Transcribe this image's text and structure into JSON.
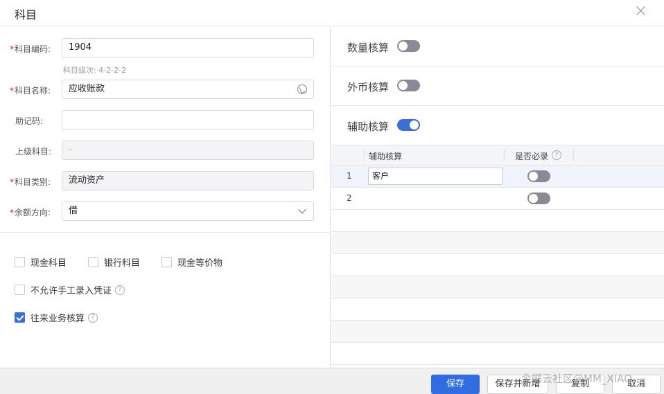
{
  "dialog": {
    "title": "科目"
  },
  "form": {
    "code": {
      "label": "科目编码:",
      "value": "1904",
      "required": true,
      "hint": "科目级次: 4-2-2-2"
    },
    "name": {
      "label": "科目名称:",
      "value": "应收账款",
      "required": true
    },
    "mnemonic": {
      "label": "助记码:",
      "value": ""
    },
    "parent": {
      "label": "上级科目:",
      "value": "-"
    },
    "category": {
      "label": "科目类别:",
      "value": "流动资产",
      "required": true
    },
    "balance_direction": {
      "label": "余额方向:",
      "value": "借",
      "required": true
    }
  },
  "options": {
    "cash": {
      "label": "现金科目",
      "checked": false
    },
    "bank": {
      "label": "银行科目",
      "checked": false
    },
    "cash_equivalent": {
      "label": "现金等价物",
      "checked": false
    },
    "no_manual_entry": {
      "label": "不允许手工录入凭证",
      "checked": false
    },
    "ar_ap": {
      "label": "往来业务核算",
      "checked": true
    },
    "help_glyph": "?"
  },
  "accounting": {
    "quantity": {
      "label": "数量核算",
      "on": false
    },
    "foreign_currency": {
      "label": "外币核算",
      "on": false
    },
    "auxiliary": {
      "label": "辅助核算",
      "on": true
    }
  },
  "aux_table": {
    "columns": {
      "aux": "辅助核算",
      "required": "是否必录",
      "help_glyph": "?"
    },
    "rows": [
      {
        "num": "1",
        "aux": "客户",
        "required": false
      },
      {
        "num": "2",
        "aux": "",
        "required": false
      }
    ]
  },
  "footer": {
    "save": "保存",
    "save_new": "保存并新增",
    "copy": "复制",
    "cancel": "取消"
  },
  "watermark": "金蝶云社区@MM_XIAO",
  "colors": {
    "accent": "#2f6de0",
    "required": "#e02020"
  }
}
